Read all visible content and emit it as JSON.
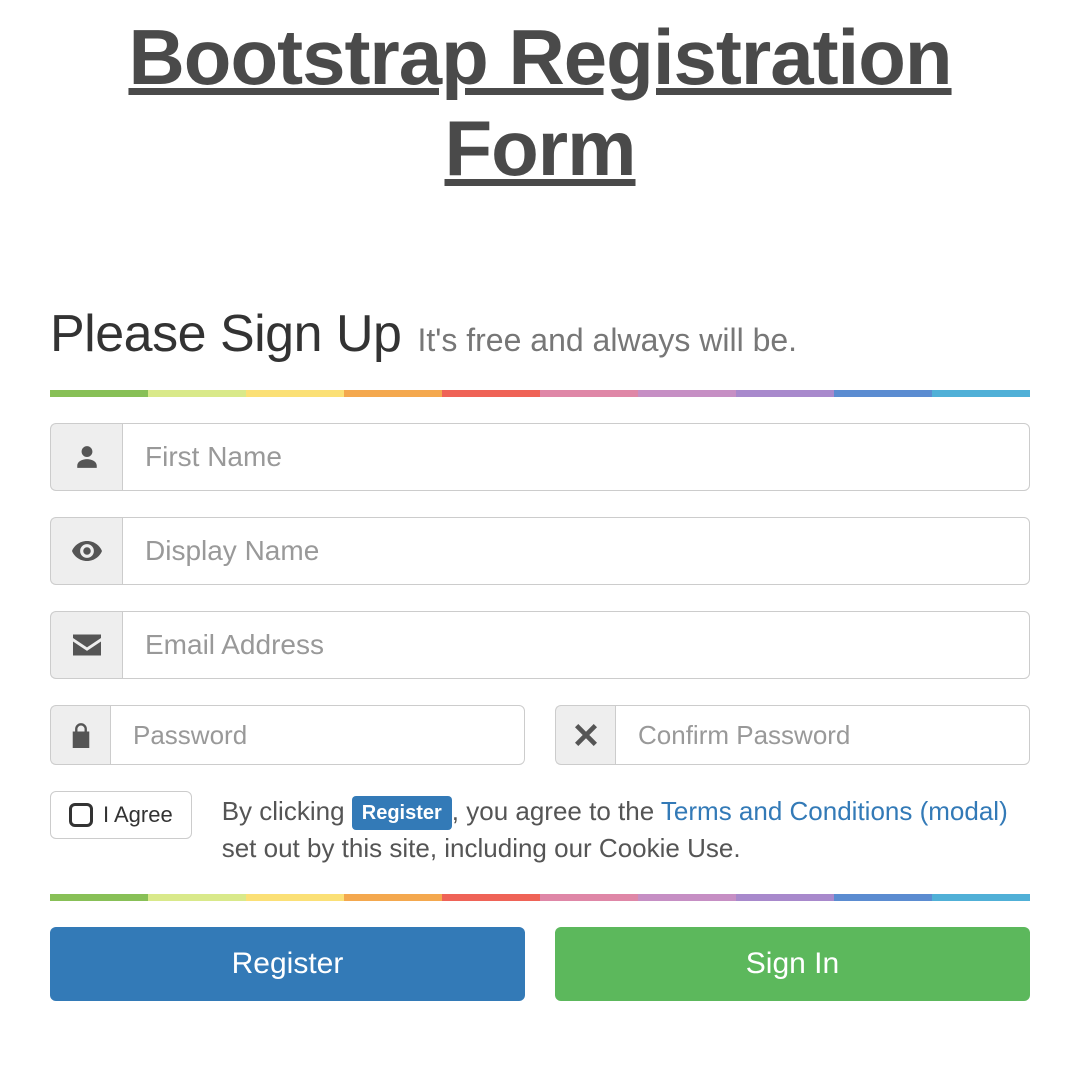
{
  "title": "Bootstrap Registration Form",
  "heading": "Please Sign Up",
  "subheading": "It's free and always will be.",
  "fields": {
    "first_name_placeholder": "First Name",
    "display_name_placeholder": "Display Name",
    "email_placeholder": "Email Address",
    "password_placeholder": "Password",
    "confirm_password_placeholder": "Confirm Password"
  },
  "agree_label": "I Agree",
  "legal": {
    "t1": "By clicking ",
    "badge": "Register",
    "t2": ", you agree to the ",
    "terms_link": "Terms and Conditions (modal)",
    "t3": " set out by this site, including our Cookie Use."
  },
  "register_label": "Register",
  "signin_label": "Sign In"
}
